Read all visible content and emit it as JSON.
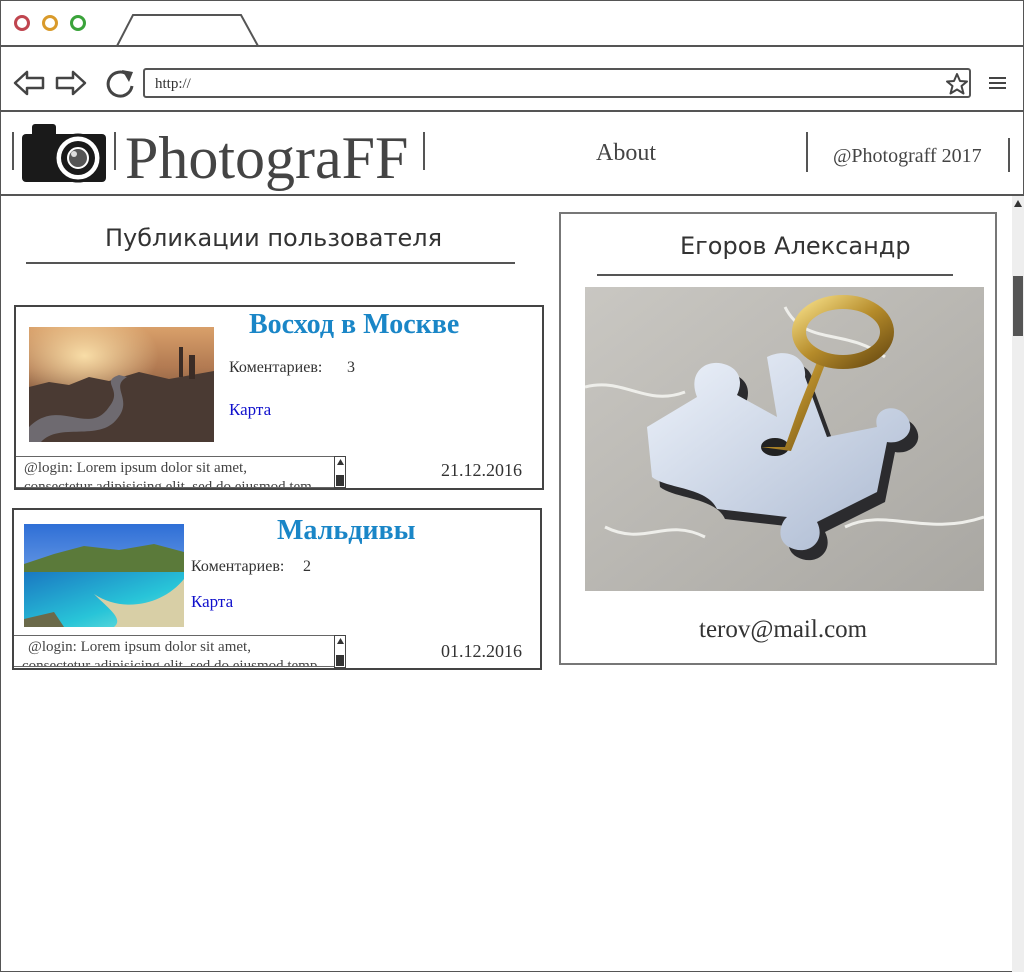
{
  "browser": {
    "url": "http://",
    "colors": {
      "close": "#c0454f",
      "minimize": "#d99a2b",
      "maximize": "#3aa33a"
    }
  },
  "header": {
    "brand": "PhotograFF",
    "about": "About",
    "copyright": "@Photograff 2017"
  },
  "publications": {
    "title": "Публикации пользователя",
    "comments_label": "Коментариев:",
    "map_label": "Карта",
    "posts": [
      {
        "title": "Восход в Москве",
        "comments_count": "3",
        "comment_line1": "@login:  Lorem ipsum dolor sit       amet,",
        "comment_line2": "consectetur adipisicing elit, sed do eiusmod tem",
        "date": "21.12.2016"
      },
      {
        "title": "Мальдивы",
        "comments_count": "2",
        "comment_line1": "@login:  Lorem ipsum dolor sit       amet,",
        "comment_line2": "consectetur adipisicing elit, sed do eiusmod temp",
        "date": "01.12.2016"
      }
    ]
  },
  "profile": {
    "name": "Егоров Александр",
    "email": "terov@mail.com"
  }
}
